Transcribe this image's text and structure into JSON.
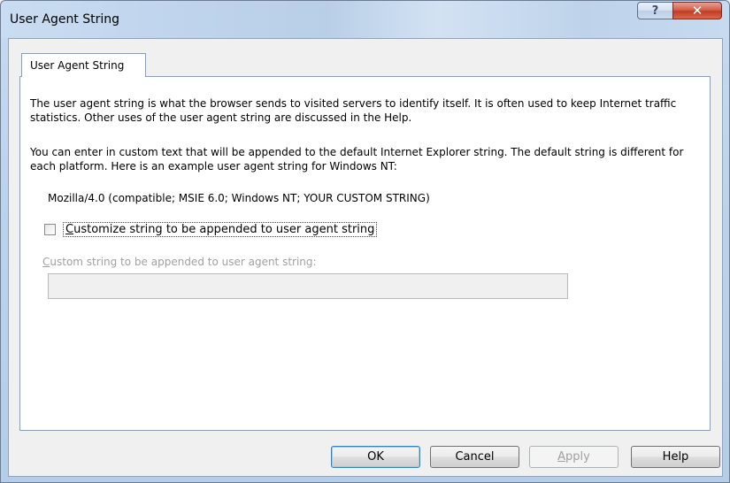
{
  "window": {
    "title": "User Agent String",
    "help_glyph": "?",
    "close_glyph": "✕"
  },
  "tabs": [
    {
      "label": "User Agent String",
      "active": true
    }
  ],
  "content": {
    "description": "The user agent string is what the browser sends to visited servers to identify itself. It is often used to keep Internet traffic statistics. Other uses of the user agent string are discussed in the Help.",
    "custom_text_info": "You can enter in custom text that will be appended to the default Internet Explorer string. The default string is different for each platform. Here is an example user agent string for Windows NT:",
    "example_string": "Mozilla/4.0 (compatible; MSIE 6.0; Windows NT; YOUR CUSTOM STRING)",
    "checkbox": {
      "mnemonic": "C",
      "label_rest": "ustomize string to be appended to user agent string",
      "checked": false
    },
    "custom_field": {
      "label_mnemonic": "C",
      "label_rest": "ustom string to be appended to user agent string:",
      "value": "",
      "enabled": false
    }
  },
  "buttons": {
    "ok": "OK",
    "cancel": "Cancel",
    "apply_mnemonic": "A",
    "apply_rest": "pply",
    "help": "Help"
  }
}
